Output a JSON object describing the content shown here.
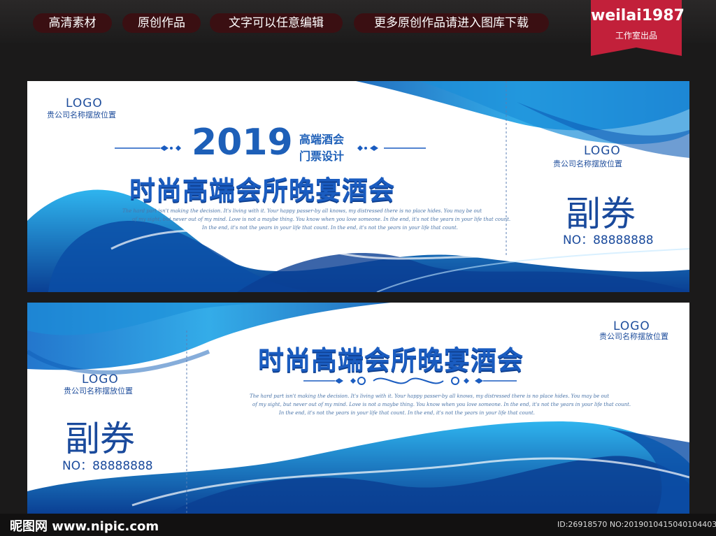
{
  "top_tags": [
    "高清素材",
    "原创作品",
    "文字可以任意编辑",
    "更多原创作品请进入图库下载"
  ],
  "badge": {
    "name": "weilai1987",
    "caption": "工作室出品"
  },
  "ticket1": {
    "logo": "LOGO",
    "company": "贵公司名称摆放位置",
    "year": "2019",
    "line1": "高端酒会",
    "line2": "门票设计",
    "title": "时尚高端会所晚宴酒会",
    "eng1": "The hard part isn't making the decision. It's living with it. Your happy passer-by all knows, my distressed there is no place hides. You may be out",
    "eng2": "of my sight, but never out of my mind. Love is not a maybe thing. You know when you love someone. In the end, it's not the years in your life that count.",
    "eng3": "In the end, it's not the years in your life that count. In the end, it's not the years in your life that count.",
    "stub_logo": "LOGO",
    "stub_company": "贵公司名称摆放位置",
    "stub_label": "副券",
    "stub_no": "NO：88888888"
  },
  "ticket2": {
    "logo": "LOGO",
    "company": "贵公司名称摆放位置",
    "title": "时尚高端会所晚宴酒会",
    "eng1": "The hard part isn't making the decision. It's living with it. Your happy passer-by all knows, my distressed there is no place hides. You may be out",
    "eng2": "of my sight, but never out of my mind. Love is not a maybe thing. You know when you love someone. In the end, it's not the years in your life that count.",
    "eng3": "In the end, it's not the years in your life that count. In the end, it's not the years in your life that count.",
    "stub_logo": "LOGO",
    "stub_company": "贵公司名称摆放位置",
    "stub_label": "副券",
    "stub_no": "NO：88888888"
  },
  "footer": {
    "site": "昵图网 www.nipic.com",
    "id": "ID:26918570 NO:20190104150401044030"
  }
}
